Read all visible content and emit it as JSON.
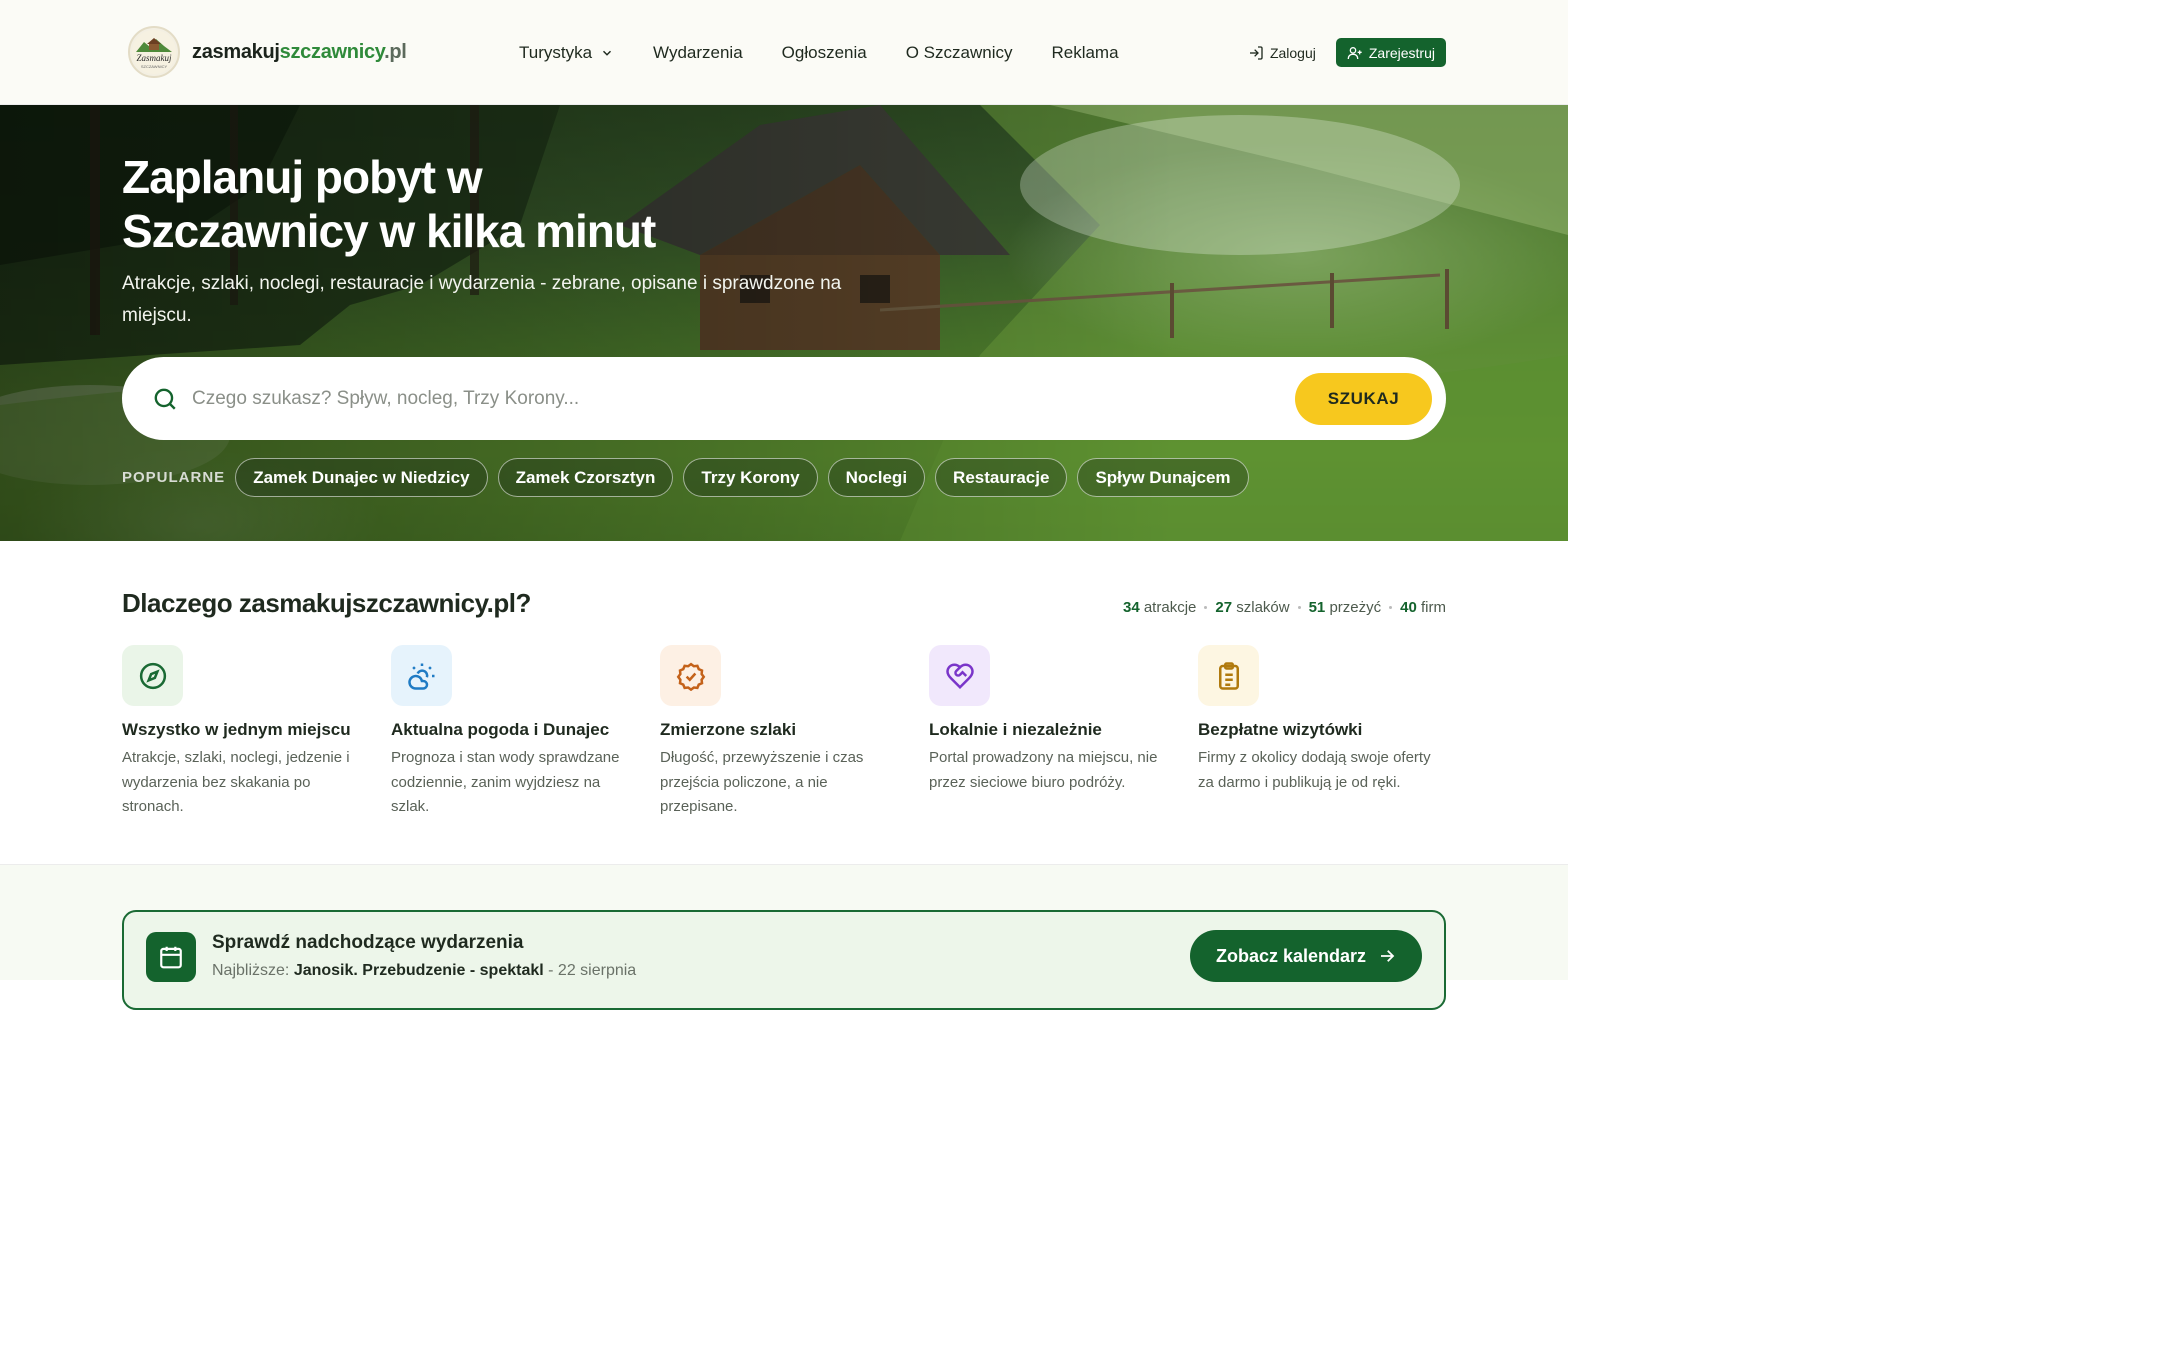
{
  "brand": {
    "name_part1": "zasmakuj",
    "name_part2": "szczawnicy",
    "name_part3": ".pl",
    "logo_icon": "zasmakuj-logo-badge"
  },
  "nav": {
    "items": [
      "Turystyka",
      "Wydarzenia",
      "Ogłoszenia",
      "O Szczawnicy",
      "Reklama"
    ],
    "login_label": "Zaloguj",
    "register_label": "Zarejestruj"
  },
  "hero": {
    "title": "Zaplanuj pobyt w Szczawnicy w kilka minut",
    "subtitle": "Atrakcje, szlaki, noclegi, restauracje i wydarzenia - zebrane, opisane i sprawdzone na miejscu.",
    "search_placeholder": "Czego szukasz? Spływ, nocleg, Trzy Korony...",
    "search_button": "SZUKAJ",
    "popular_label": "POPULARNE",
    "popular_tags": [
      "Zamek Dunajec w Niedzicy",
      "Zamek Czorsztyn",
      "Trzy Korony",
      "Noclegi",
      "Restauracje",
      "Spływ Dunajcem"
    ]
  },
  "why": {
    "title": "Dlaczego zasmakujszczawnicy.pl?",
    "stats": [
      {
        "value": "34",
        "label": "atrakcje"
      },
      {
        "value": "27",
        "label": "szlaków"
      },
      {
        "value": "51",
        "label": "przeżyć"
      },
      {
        "value": "40",
        "label": "firm"
      }
    ],
    "features": [
      {
        "title": "Wszystko w jednym miejscu",
        "desc": "Atrakcje, szlaki, noclegi, jedzenie i wydarzenia bez skakania po stronach.",
        "icon": "compass-icon"
      },
      {
        "title": "Aktualna pogoda i Dunajec",
        "desc": "Prognoza i stan wody sprawdzane codziennie, zanim wyjdziesz na szlak.",
        "icon": "sun-cloud-icon"
      },
      {
        "title": "Zmierzone szlaki",
        "desc": "Długość, przewyższenie i czas przejścia policzone, a nie przepisane.",
        "icon": "badge-check-icon"
      },
      {
        "title": "Lokalnie i niezależnie",
        "desc": "Portal prowadzony na miejscu, nie przez sieciowe biuro podróży.",
        "icon": "heart-handshake-icon"
      },
      {
        "title": "Bezpłatne wizytówki",
        "desc": "Firmy z okolicy dodają swoje oferty za darmo i publikują je od ręki.",
        "icon": "clipboard-list-icon"
      }
    ]
  },
  "events": {
    "title": "Sprawdź nadchodzące wydarzenia",
    "next_label": "Najbliższe:",
    "next_name": "Janosik. Przebudzenie - spektakl",
    "next_date": "- 22 sierpnia",
    "button_label": "Zobacz kalendarz"
  },
  "colors": {
    "brand_green": "#14632d",
    "accent_yellow": "#f7c81e"
  }
}
